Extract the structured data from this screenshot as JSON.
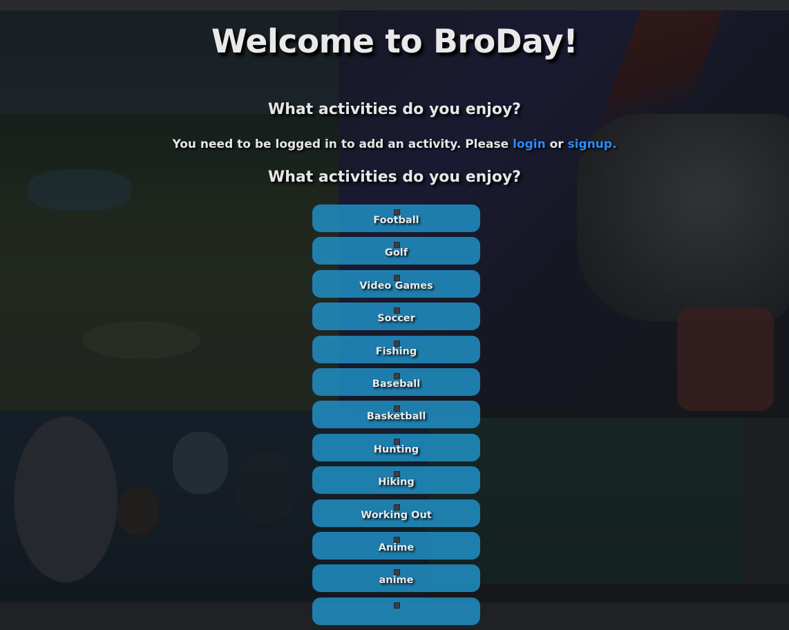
{
  "page": {
    "title": "Welcome to BroDay!",
    "subtitle_top": "What activities do you enjoy?",
    "login_message": {
      "prefix": "You need to be logged in to add an activity. Please ",
      "login_link": "login",
      "middle": " or ",
      "signup_link": "signup."
    },
    "subtitle_list": "What activities do you enjoy?"
  },
  "activities": [
    {
      "label": "Football",
      "checked": false
    },
    {
      "label": "Golf",
      "checked": false
    },
    {
      "label": "Video Games",
      "checked": false
    },
    {
      "label": "Soccer",
      "checked": false
    },
    {
      "label": "Fishing",
      "checked": false
    },
    {
      "label": "Baseball",
      "checked": false
    },
    {
      "label": "Basketball",
      "checked": false
    },
    {
      "label": "Hunting",
      "checked": false
    },
    {
      "label": "Hiking",
      "checked": false
    },
    {
      "label": "Working Out",
      "checked": false
    },
    {
      "label": "Anime",
      "checked": false
    },
    {
      "label": "anime",
      "checked": false
    },
    {
      "label": "",
      "checked": false
    }
  ],
  "colors": {
    "link": "#2a8cff",
    "activity_button": "#2194ca",
    "text": "#e6e6e6"
  }
}
